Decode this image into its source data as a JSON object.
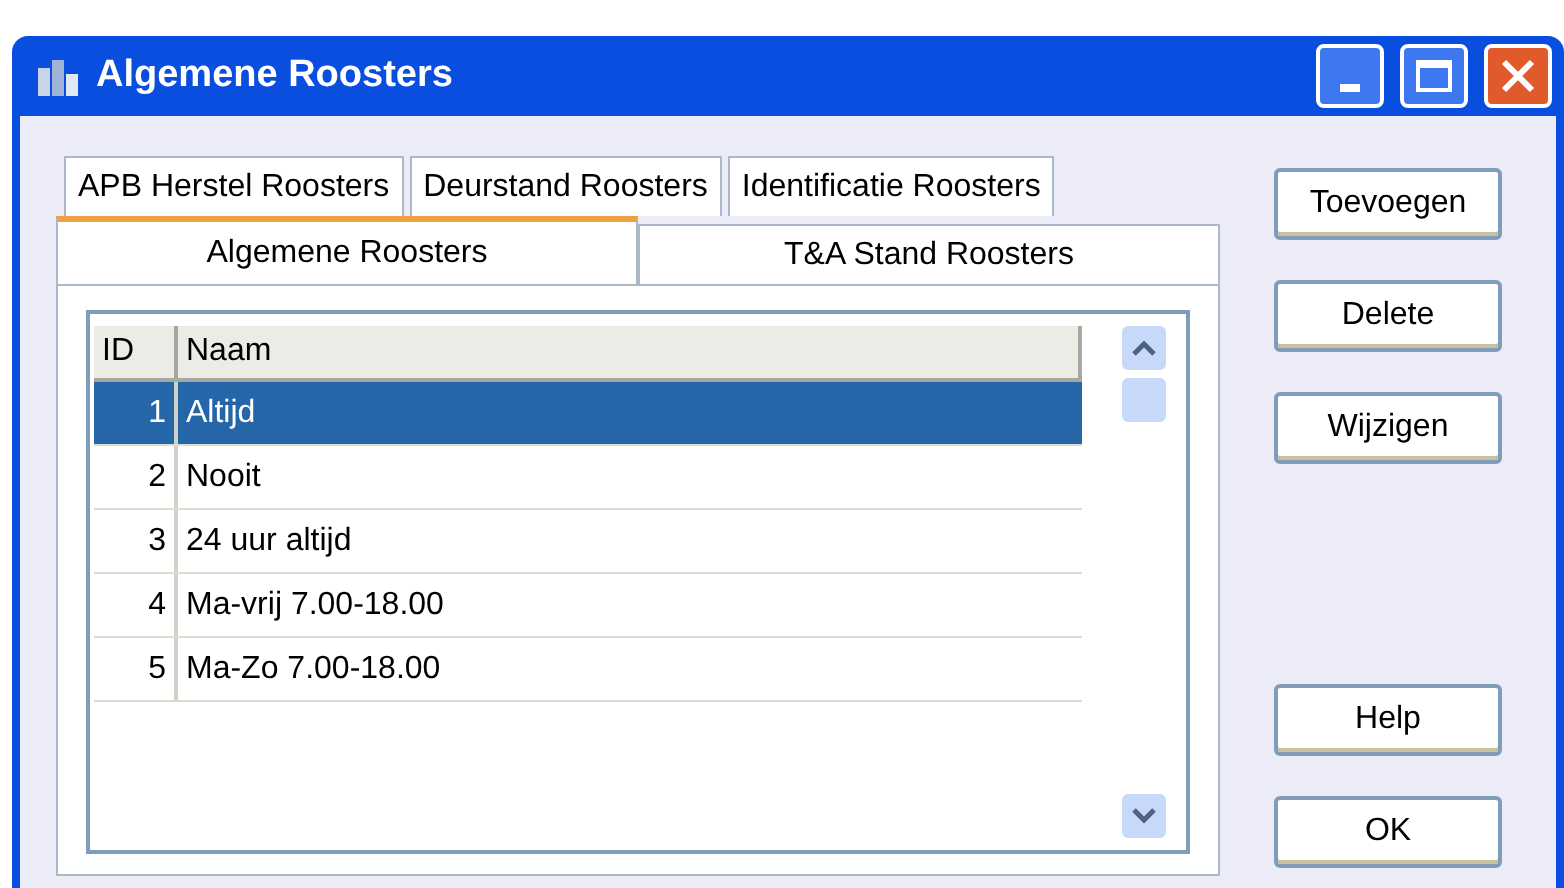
{
  "window": {
    "title": "Algemene Roosters"
  },
  "tab_rows": [
    [
      {
        "label": "APB Herstel Roosters",
        "selected": false
      },
      {
        "label": "Deurstand Roosters",
        "selected": false
      },
      {
        "label": "Identificatie Roosters",
        "selected": false
      }
    ],
    [
      {
        "label": "Algemene Roosters",
        "selected": true
      },
      {
        "label": "T&A Stand Roosters",
        "selected": false
      }
    ]
  ],
  "table": {
    "columns": [
      "ID",
      "Naam"
    ],
    "rows": [
      {
        "id": "1",
        "naam": "Altijd",
        "selected": true
      },
      {
        "id": "2",
        "naam": "Nooit",
        "selected": false
      },
      {
        "id": "3",
        "naam": "24 uur altijd",
        "selected": false
      },
      {
        "id": "4",
        "naam": "Ma-vrij 7.00-18.00",
        "selected": false
      },
      {
        "id": "5",
        "naam": "Ma-Zo 7.00-18.00",
        "selected": false
      }
    ]
  },
  "buttons_top": [
    "Toevoegen",
    "Delete",
    "Wijzigen"
  ],
  "buttons_bottom": [
    "Help",
    "OK"
  ]
}
